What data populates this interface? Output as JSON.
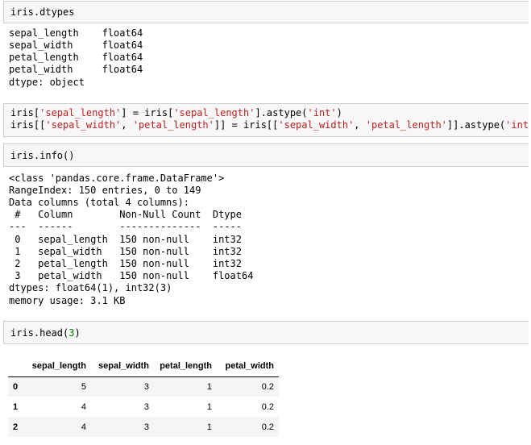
{
  "cells": {
    "c1": {
      "code": "iris.dtypes"
    },
    "c1_output": [
      "sepal_length    float64",
      "sepal_width     float64",
      "petal_length    float64",
      "petal_width     float64",
      "dtype: object"
    ],
    "c2": {
      "line1": {
        "a": "iris[",
        "b": "'sepal_length'",
        "c": "] = iris[",
        "d": "'sepal_length'",
        "e": "].astype(",
        "f": "'int'",
        "g": ")"
      },
      "line2": {
        "a": "iris[[",
        "b": "'sepal_width'",
        "c": ", ",
        "d": "'petal_length'",
        "e": "]] = iris[[",
        "f": "'sepal_width'",
        "g": ", ",
        "h": "'petal_length'",
        "i": "]].astype(",
        "j": "'int'",
        "k": ")"
      }
    },
    "c3": {
      "code": "iris.info()"
    },
    "c3_output": [
      "<class 'pandas.core.frame.DataFrame'>",
      "RangeIndex: 150 entries, 0 to 149",
      "Data columns (total 4 columns):",
      " #   Column        Non-Null Count  Dtype",
      "---  ------        --------------  -----",
      " 0   sepal_length  150 non-null    int32",
      " 1   sepal_width   150 non-null    int32",
      " 2   petal_length  150 non-null    int32",
      " 3   petal_width   150 non-null    float64",
      "dtypes: float64(1), int32(3)",
      "memory usage: 3.1 KB"
    ],
    "c4": {
      "a": "iris.head(",
      "b": "3",
      "c": ")"
    }
  },
  "dataframe": {
    "columns": [
      "sepal_length",
      "sepal_width",
      "petal_length",
      "petal_width"
    ],
    "rows": [
      {
        "index": "0",
        "values": [
          "5",
          "3",
          "1",
          "0.2"
        ]
      },
      {
        "index": "1",
        "values": [
          "4",
          "3",
          "1",
          "0.2"
        ]
      },
      {
        "index": "2",
        "values": [
          "4",
          "3",
          "1",
          "0.2"
        ]
      }
    ]
  },
  "colors": {
    "string": "#ba2121",
    "number": "#008000",
    "cell_bg": "#f7f7f7",
    "cell_border": "#cfcfcf"
  }
}
